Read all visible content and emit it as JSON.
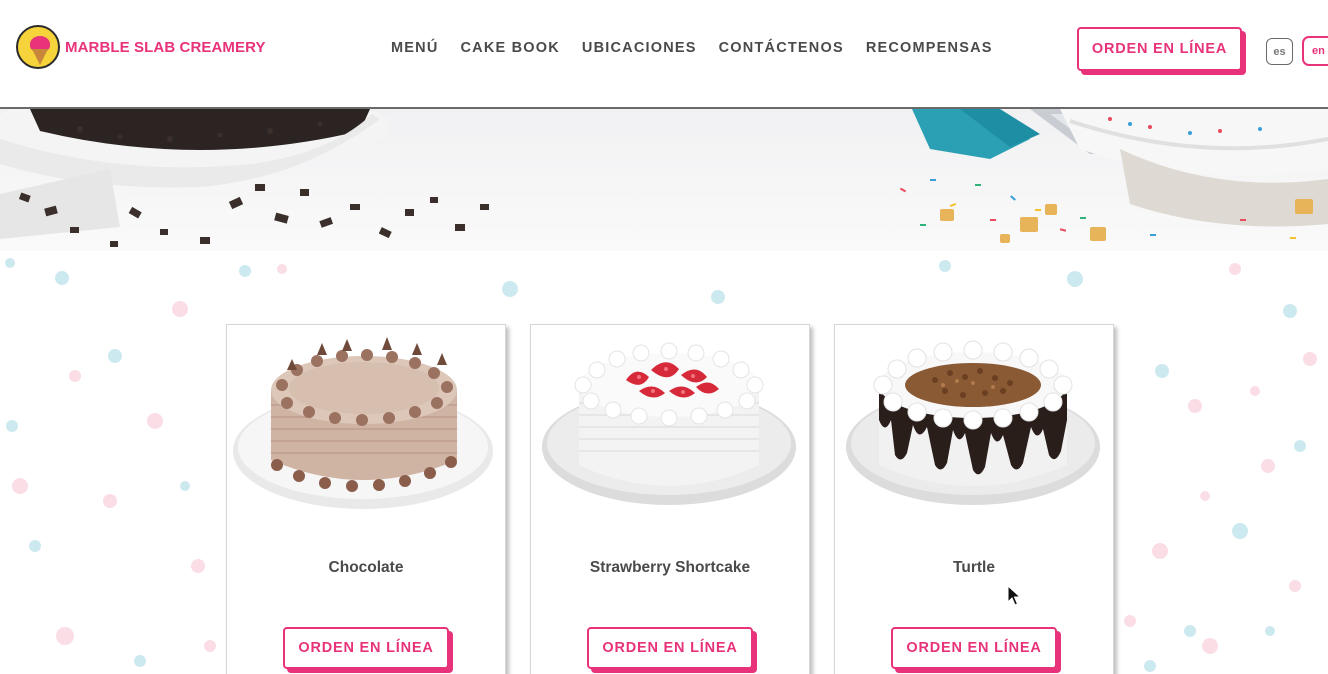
{
  "brand": {
    "name": "MARBLE SLAB CREAMERY",
    "colors": {
      "accent": "#e8327a",
      "text": "#4a4a4a",
      "logo_yellow": "#f6d33b"
    }
  },
  "nav": {
    "items": [
      "MENÚ",
      "CAKE BOOK",
      "UBICACIONES",
      "CONTÁCTENOS",
      "RECOMPENSAS"
    ]
  },
  "header": {
    "order_label": "ORDEN EN LÍNEA",
    "lang_es": "es",
    "lang_en": "en"
  },
  "cakes": [
    {
      "name": "Chocolate",
      "order_label": "ORDEN EN LÍNEA"
    },
    {
      "name": "Strawberry Shortcake",
      "order_label": "ORDEN EN LÍNEA"
    },
    {
      "name": "Turtle",
      "order_label": "ORDEN EN LÍNEA"
    }
  ]
}
